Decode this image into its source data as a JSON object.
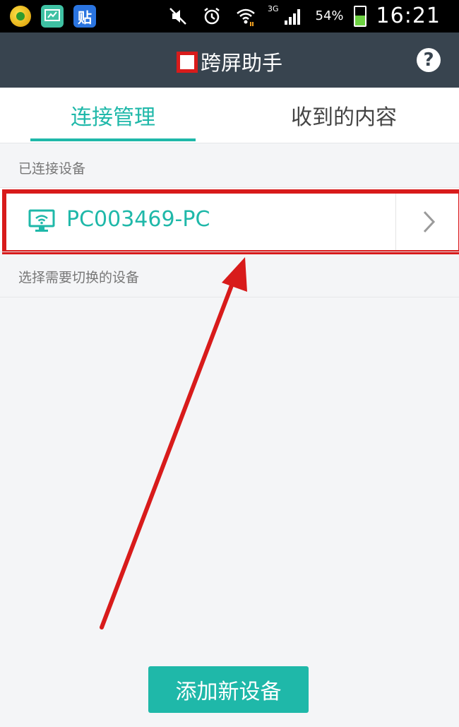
{
  "status_bar": {
    "network": "3G",
    "battery": "54%",
    "time": "16:21",
    "app_icons": [
      "ball-app-icon",
      "screen-app-icon",
      "tie-app-icon"
    ],
    "tie_app_glyph": "贴"
  },
  "header": {
    "title": "跨屏助手",
    "help_glyph": "?"
  },
  "tabs": [
    {
      "label": "连接管理",
      "active": true
    },
    {
      "label": "收到的内容",
      "active": false
    }
  ],
  "connected_section": {
    "label": "已连接设备",
    "devices": [
      {
        "name": "PC003469-PC"
      }
    ]
  },
  "select_section": {
    "label": "选择需要切换的设备"
  },
  "add_button": {
    "label": "添加新设备"
  },
  "colors": {
    "accent": "#1fb8a9",
    "header_bg": "#38444f",
    "annotation_red": "#d81b1b"
  }
}
